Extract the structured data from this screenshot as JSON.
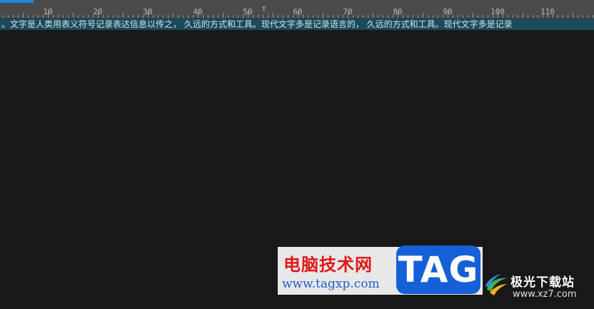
{
  "ruler": {
    "numbers": [
      "10",
      "20",
      "30",
      "40",
      "50",
      "60",
      "70",
      "80",
      "90",
      "100",
      "110"
    ],
    "tab_marker": "T"
  },
  "editor": {
    "line": "。文字是人类用表义符号记录表达信息以传之， 久远的方式和工具。现代文字多是记录语言的， 久远的方式和工具。现代文字多是记录"
  },
  "watermark": {
    "cn_text": "电脑技术网",
    "url": "www.tagxp.com",
    "tag": "TAG",
    "logo_text": "极光下载站",
    "logo_url": "www.xz7.com"
  },
  "colors": {
    "ruler_bg": "#4a4a4a",
    "ruler_accent": "#1e88d8",
    "editor_bg": "#181818",
    "selection_bg": "#1a4a5c",
    "watermark_red": "#e01818",
    "watermark_blue": "#1560d6"
  }
}
